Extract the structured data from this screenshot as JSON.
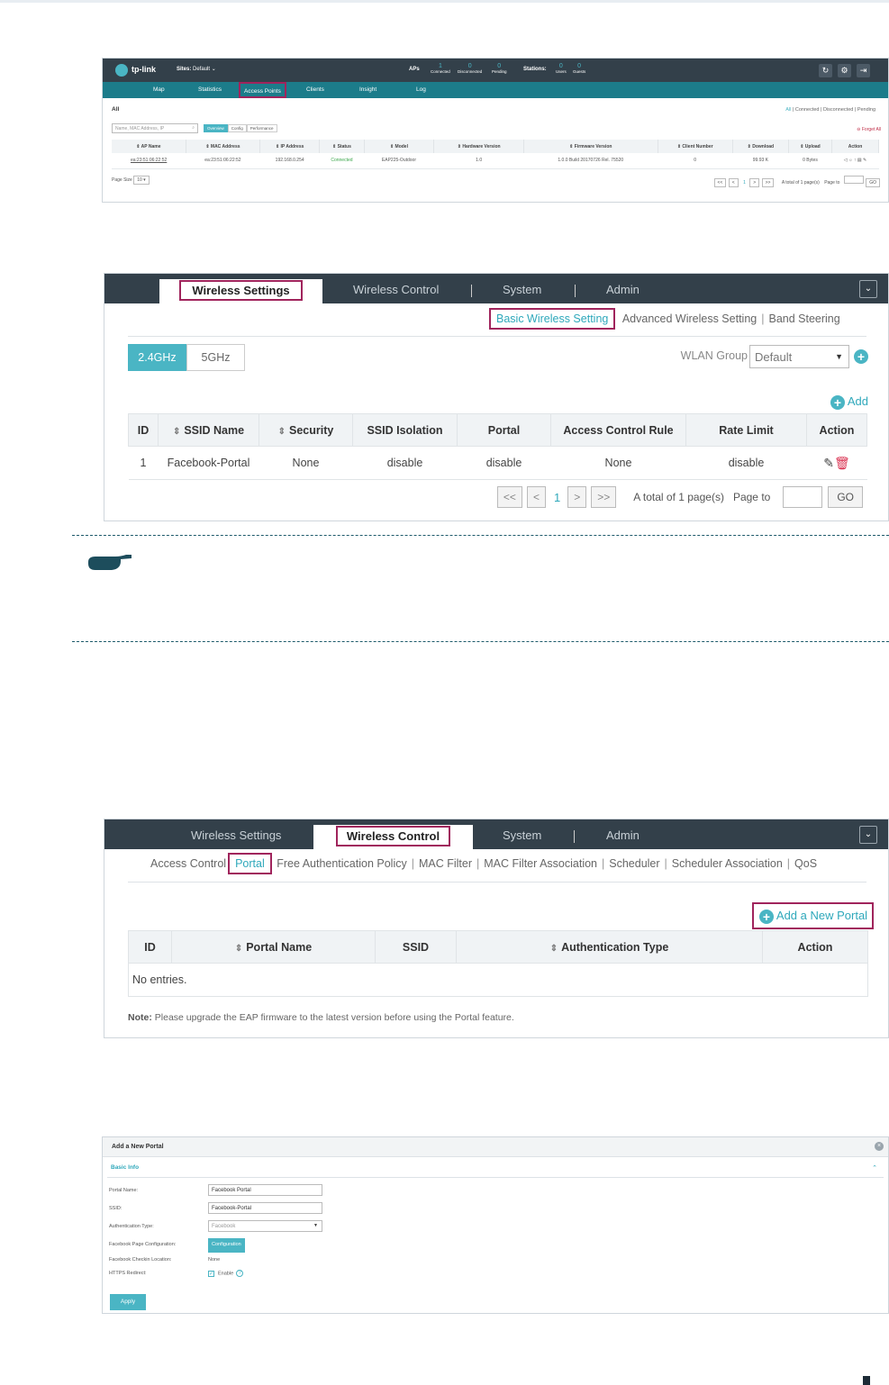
{
  "screen1": {
    "logo": "tp-link",
    "sites_label": "Sites:",
    "sites_value": "Default",
    "aps_label": "APs",
    "aps": [
      {
        "num": "1",
        "label": "Connected"
      },
      {
        "num": "0",
        "label": "Disconnected"
      },
      {
        "num": "0",
        "label": "Pending"
      }
    ],
    "stations_label": "Stations:",
    "stations": [
      {
        "num": "0",
        "label": "Users"
      },
      {
        "num": "0",
        "label": "Guests"
      }
    ],
    "nav": [
      "Map",
      "Statistics",
      "Access Points",
      "Clients",
      "Insight",
      "Log"
    ],
    "all_title": "All",
    "filters": [
      "All",
      "Connected",
      "Disconnected",
      "Pending"
    ],
    "search_placeholder": "Name, MAC Address, IP",
    "views": [
      "Overview",
      "Config",
      "Performance"
    ],
    "forget_all": "Forget All",
    "columns": [
      "AP Name",
      "MAC Address",
      "IP Address",
      "Status",
      "Model",
      "Hardware Version",
      "Firmware Version",
      "Client Number",
      "Download",
      "Upload",
      "Action"
    ],
    "row": [
      "ea:23:51:06:22:52",
      "ea:23:51:06:22:52",
      "192.168.0.254",
      "Connected",
      "EAP225-Outdoor",
      "1.0",
      "1.0.0 Build 20170726 Rel. 75520",
      "0",
      "99.93 K",
      "0 Bytes"
    ],
    "page_size_label": "Page Size",
    "page_size_value": "10",
    "pager_current": "1",
    "pager_total": "A total of 1 page(s)",
    "page_to": "Page to",
    "go": "GO"
  },
  "screen2": {
    "tabs": [
      "Wireless Settings",
      "Wireless Control",
      "System",
      "Admin"
    ],
    "subnav": [
      "Basic Wireless Setting",
      "Advanced Wireless Setting",
      "Band Steering"
    ],
    "freq": [
      "2.4GHz",
      "5GHz"
    ],
    "wlan_group_label": "WLAN Group",
    "wlan_group_value": "Default",
    "add_label": "Add",
    "columns": [
      "ID",
      "SSID Name",
      "Security",
      "SSID Isolation",
      "Portal",
      "Access Control Rule",
      "Rate Limit",
      "Action"
    ],
    "row": [
      "1",
      "Facebook-Portal",
      "None",
      "disable",
      "disable",
      "None",
      "disable"
    ],
    "pager": {
      "first": "<<",
      "prev": "<",
      "current": "1",
      "next": ">",
      "last": ">>",
      "total": "A total of 1 page(s)",
      "page_to": "Page to",
      "go": "GO"
    }
  },
  "screen3": {
    "tabs": [
      "Wireless Settings",
      "Wireless Control",
      "System",
      "Admin"
    ],
    "subnav": [
      "Access Control",
      "Portal",
      "Free Authentication Policy",
      "MAC Filter",
      "MAC Filter Association",
      "Scheduler",
      "Scheduler Association",
      "QoS"
    ],
    "add_portal": "Add a New Portal",
    "columns": [
      "ID",
      "Portal Name",
      "SSID",
      "Authentication Type",
      "Action"
    ],
    "empty": "No entries.",
    "note_label": "Note:",
    "note_text": "Please upgrade the EAP firmware to the latest version before using the Portal feature."
  },
  "screen4": {
    "title": "Add a New Portal",
    "section": "Basic Info",
    "labels": [
      "Portal Name:",
      "SSID:",
      "Authentication Type:",
      "Facebook Page Configuration:",
      "Facebook Checkin Location:",
      "HTTPS Redirect:"
    ],
    "portal_name": "Facebook Portal",
    "ssid": "Facebook-Portal",
    "auth_type": "Facebook",
    "config_button": "Configuration",
    "checkin_location": "None",
    "enable_label": "Enable",
    "apply": "Apply"
  },
  "colors": {
    "accent": "#4ab5c4",
    "highlight": "#a0245c",
    "header_dark": "#33404a"
  }
}
